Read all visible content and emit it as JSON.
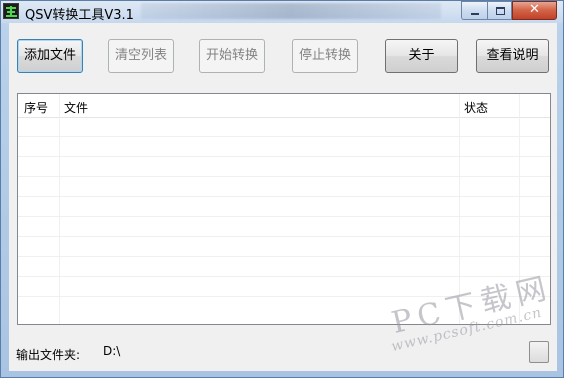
{
  "window": {
    "title": "QSV转换工具V3.1"
  },
  "toolbar": {
    "add_file": "添加文件",
    "clear_list": "清空列表",
    "start_convert": "开始转换",
    "stop_convert": "停止转换",
    "about": "关于",
    "view_help": "查看说明"
  },
  "file_list": {
    "columns": [
      "序号",
      "文件",
      "状态"
    ],
    "rows": []
  },
  "output": {
    "label": "输出文件夹:",
    "path": "D:\\"
  },
  "watermark": {
    "brand": "PC下载网",
    "url": "www.pcsoft.com.cn"
  },
  "icons": {
    "app": "app-icon",
    "minimize": "minimize-icon",
    "maximize": "maximize-icon",
    "close": "close-icon"
  }
}
